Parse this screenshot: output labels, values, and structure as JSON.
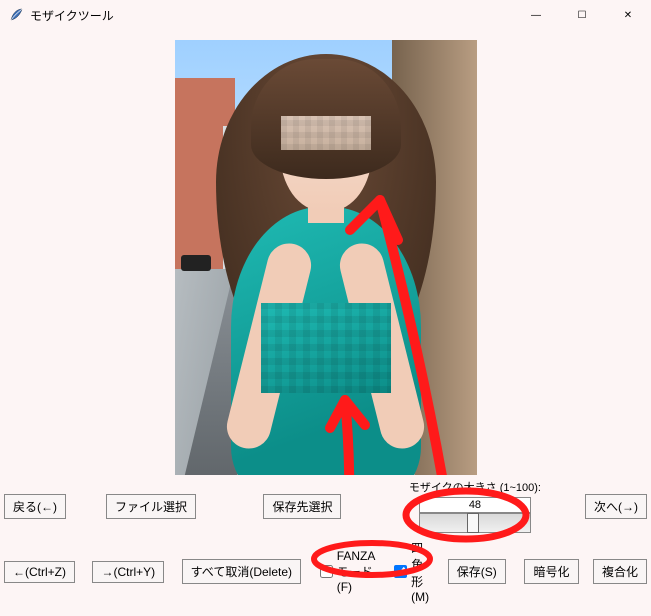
{
  "title": "モザイクツール",
  "size": {
    "label": "モザイクの大きさ (1~100):",
    "value": "48",
    "min": 1,
    "max": 100,
    "current": 48
  },
  "buttons": {
    "back": "戻る(←)",
    "file_select": "ファイル選択",
    "save_dest": "保存先選択",
    "next": "次へ(→)",
    "undo": "←(Ctrl+Z)",
    "redo": "→(Ctrl+Y)",
    "cancel_all": "すべて取消(Delete)",
    "save": "保存(S)",
    "encrypt": "暗号化",
    "composite": "複合化"
  },
  "checkboxes": {
    "fanza": {
      "label": "FANZAモード(F)",
      "checked": false
    },
    "rect": {
      "label": "四角形(M)",
      "checked": true
    }
  },
  "window_controls": {
    "minimize": "—",
    "maximize": "☐",
    "close": "✕"
  },
  "app_icon_glyph": "feather"
}
